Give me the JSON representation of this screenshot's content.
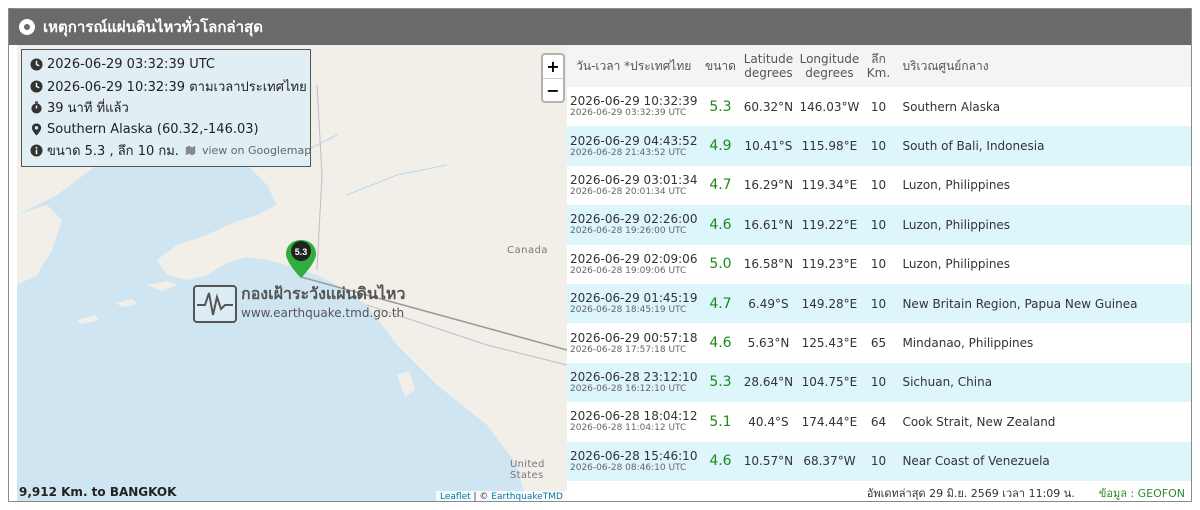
{
  "title": "เหตุการณ์แผ่นดินไหวทั่วโลกล่าสุด",
  "info": {
    "utc_time": "2026-06-29 03:32:39 UTC",
    "thai_time": "2026-06-29 10:32:39 ตามเวลาประเทศไทย",
    "ago": "39 นาที ที่แล้ว",
    "place": "Southern Alaska (60.32,-146.03)",
    "magnitude_depth": "ขนาด 5.3 , ลึก 10 กม.",
    "googlemap_link": "view on Googlemap"
  },
  "map": {
    "zoom_in": "+",
    "zoom_out": "−",
    "label_canada": "Canada",
    "label_us": "United States",
    "marker_label": "5.3",
    "watermark_title": "กองเฝ้าระวังแผ่นดินไหว",
    "watermark_url": "www.earthquake.tmd.go.th",
    "attribution_leaflet": "Leaflet",
    "attribution_sep": " | © ",
    "attribution_owner": "EarthquakeTMD",
    "distance": "9,912 Km. to BANGKOK"
  },
  "table": {
    "headers": {
      "datetime": "วัน-เวลา *ประเทศไทย",
      "magnitude": "ขนาด",
      "lat_1": "Latitude",
      "lat_2": "degrees",
      "lon_1": "Longitude",
      "lon_2": "degrees",
      "depth_1": "ลึก",
      "depth_2": "Km.",
      "location": "บริเวณศูนย์กลาง"
    },
    "rows": [
      {
        "thai": "2026-06-29 10:32:39",
        "utc": "2026-06-29 03:32:39 UTC",
        "mag": "5.3",
        "lat": "60.32°N",
        "lon": "146.03°W",
        "depth": "10",
        "loc": "Southern Alaska"
      },
      {
        "thai": "2026-06-29 04:43:52",
        "utc": "2026-06-28 21:43:52 UTC",
        "mag": "4.9",
        "lat": "10.41°S",
        "lon": "115.98°E",
        "depth": "10",
        "loc": "South of Bali, Indonesia"
      },
      {
        "thai": "2026-06-29 03:01:34",
        "utc": "2026-06-28 20:01:34 UTC",
        "mag": "4.7",
        "lat": "16.29°N",
        "lon": "119.34°E",
        "depth": "10",
        "loc": "Luzon, Philippines"
      },
      {
        "thai": "2026-06-29 02:26:00",
        "utc": "2026-06-28 19:26:00 UTC",
        "mag": "4.6",
        "lat": "16.61°N",
        "lon": "119.22°E",
        "depth": "10",
        "loc": "Luzon, Philippines"
      },
      {
        "thai": "2026-06-29 02:09:06",
        "utc": "2026-06-28 19:09:06 UTC",
        "mag": "5.0",
        "lat": "16.58°N",
        "lon": "119.23°E",
        "depth": "10",
        "loc": "Luzon, Philippines"
      },
      {
        "thai": "2026-06-29 01:45:19",
        "utc": "2026-06-28 18:45:19 UTC",
        "mag": "4.7",
        "lat": "6.49°S",
        "lon": "149.28°E",
        "depth": "10",
        "loc": "New Britain Region, Papua New Guinea"
      },
      {
        "thai": "2026-06-29 00:57:18",
        "utc": "2026-06-28 17:57:18 UTC",
        "mag": "4.6",
        "lat": "5.63°N",
        "lon": "125.43°E",
        "depth": "65",
        "loc": "Mindanao, Philippines"
      },
      {
        "thai": "2026-06-28 23:12:10",
        "utc": "2026-06-28 16:12:10 UTC",
        "mag": "5.3",
        "lat": "28.64°N",
        "lon": "104.75°E",
        "depth": "10",
        "loc": "Sichuan, China"
      },
      {
        "thai": "2026-06-28 18:04:12",
        "utc": "2026-06-28 11:04:12 UTC",
        "mag": "5.1",
        "lat": "40.4°S",
        "lon": "174.44°E",
        "depth": "64",
        "loc": "Cook Strait, New Zealand"
      },
      {
        "thai": "2026-06-28 15:46:10",
        "utc": "2026-06-28 08:46:10 UTC",
        "mag": "4.6",
        "lat": "10.57°N",
        "lon": "68.37°W",
        "depth": "10",
        "loc": "Near Coast of Venezuela"
      }
    ]
  },
  "footer": {
    "updated": "อัพเดทล่าสุด 29 มิ.ย. 2569 เวลา 11:09 น.",
    "source": "ข้อมูล : GEOFON"
  },
  "colors": {
    "title_bar": "#6a6a6a",
    "row_alt": "#ddf6fb",
    "magnitude_green": "#1a8a1a",
    "ocean": "#cfe6f2",
    "land": "#f2efe9",
    "marker": "#2fae3c"
  }
}
